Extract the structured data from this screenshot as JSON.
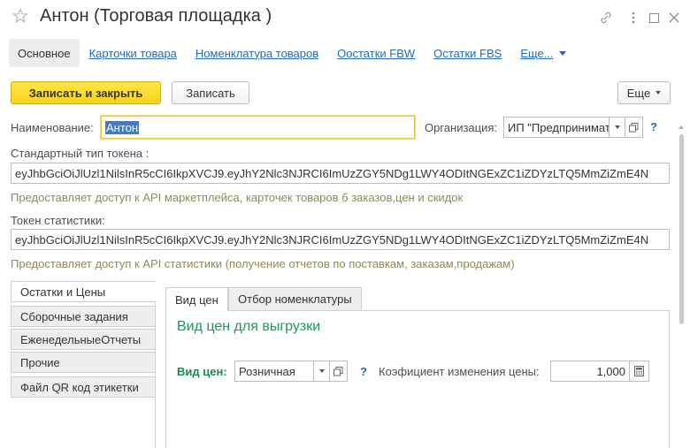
{
  "window": {
    "title": "Антон (Торговая площадка )"
  },
  "nav": {
    "tabs": [
      {
        "label": "Основное"
      },
      {
        "label": "Карточки товара"
      },
      {
        "label": "Номенклатура товаров"
      },
      {
        "label": "Оостатки  FBW"
      },
      {
        "label": "Остатки FBS"
      },
      {
        "label": "Еще..."
      }
    ]
  },
  "toolbar": {
    "save_close_label": "Записать и закрыть",
    "save_label": "Записать",
    "more_label": "Еще"
  },
  "form": {
    "name_label": "Наименование:",
    "name_value": "Антон",
    "org_label": "Организация:",
    "org_value": "ИП \"Предпринимат",
    "help_mark": "?",
    "token_label": "Стандартный тип токена :",
    "token_value": "eyJhbGciOiJlUzl1NilsInR5cCI6IkpXVCJ9.eyJhY2Nlc3NJRCI6ImUzZGY5NDg1LWY4ODItNGExZC1iZDYzLTQ5MmZiZmE4N",
    "token_hint": "Предоставляет доступ к API маркетплейса, карточек товаров б заказов,цен и скидок",
    "stat_token_label": "Токен статистики:",
    "stat_token_value": "eyJhbGciOiJlUzl1NilsInR5cCI6IkpXVCJ9.eyJhY2Nlc3NJRCI6ImUzZGY5NDg1LWY4ODItNGExZC1iZDYzLTQ5MmZiZmE4N",
    "stat_token_hint": "Предоставляет доступ к API статистики (получение отчетов по поставкам, заказам,продажам)"
  },
  "side_tabs": [
    {
      "label": "Остатки и Цены"
    },
    {
      "label": "Сборочные задания"
    },
    {
      "label": "ЕженедельныеОтчеты"
    },
    {
      "label": "Прочие"
    },
    {
      "label": "Файл QR код  этикетки"
    }
  ],
  "inner_tabs": [
    {
      "label": "Вид цен"
    },
    {
      "label": "Отбор номенклатуры"
    }
  ],
  "price_panel": {
    "heading": "Вид  цен для выгрузки",
    "price_type_label": "Вид цен:",
    "price_type_value": "Розничная",
    "help_mark": "?",
    "coef_label": "Коэфициент изменения цены:",
    "coef_value": "1,000"
  }
}
